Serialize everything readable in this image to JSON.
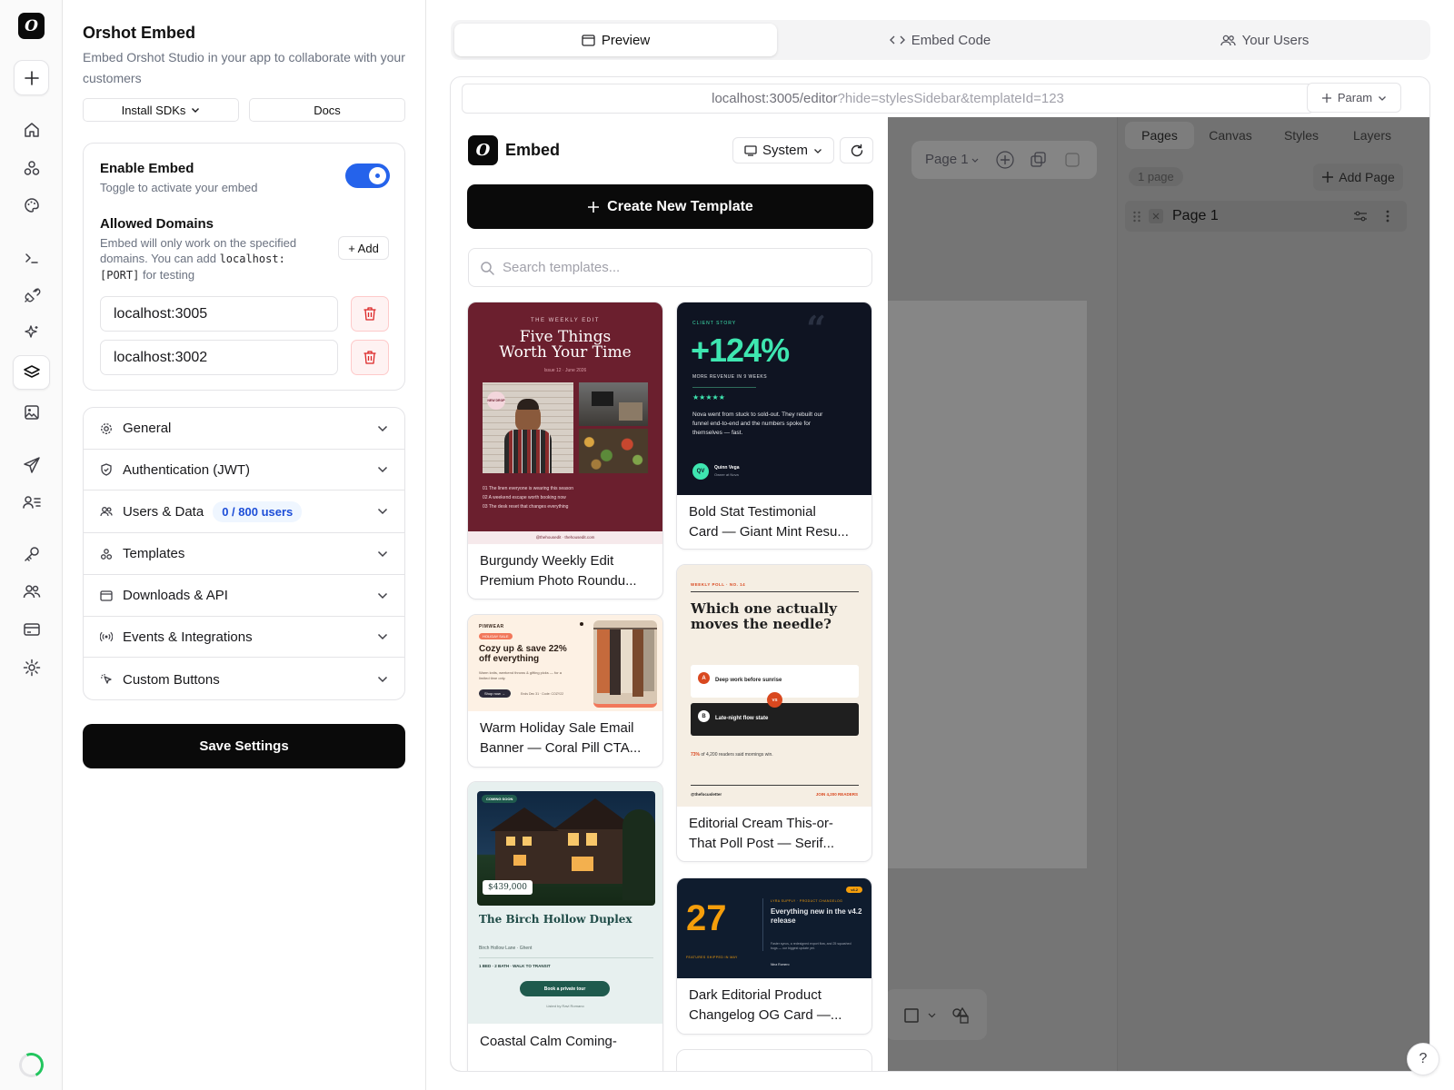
{
  "rail": {
    "logo_glyph": "O",
    "icons": [
      "plus-icon",
      "home-icon",
      "shapes-icon",
      "palette-icon",
      "terminal-icon",
      "plug-icon",
      "sparkles-icon",
      "layers-icon",
      "image-icon",
      "send-icon",
      "user-list-icon",
      "key-icon",
      "users-icon",
      "credit-card-icon",
      "settings-icon"
    ],
    "active": "layers-icon"
  },
  "panel": {
    "title": "Orshot Embed",
    "description": "Embed Orshot Studio in your app to collaborate with your customers",
    "install_sdks_label": "Install SDKs",
    "docs_label": "Docs",
    "enable": {
      "title": "Enable Embed",
      "subtitle": "Toggle to activate your embed",
      "enabled": true
    },
    "domains": {
      "title": "Allowed Domains",
      "desc_pre": "Embed will only work on the specified domains. You can add ",
      "desc_code1": "localhost:",
      "desc_code2": "[PORT]",
      "desc_post": " for testing",
      "add_label": "+ Add",
      "items": [
        "localhost:3005",
        "localhost:3002"
      ]
    },
    "sections": [
      {
        "label": "General",
        "icon": "gear-icon"
      },
      {
        "label": "Authentication (JWT)",
        "icon": "shield-check-icon"
      },
      {
        "label": "Users & Data",
        "icon": "users-icon",
        "badge": "0 / 800 users"
      },
      {
        "label": "Templates",
        "icon": "shapes-icon"
      },
      {
        "label": "Downloads & API",
        "icon": "download-icon"
      },
      {
        "label": "Events & Integrations",
        "icon": "radio-icon"
      },
      {
        "label": "Custom Buttons",
        "icon": "pointer-icon"
      }
    ],
    "save_label": "Save Settings"
  },
  "main": {
    "tabs": [
      {
        "label": "Preview",
        "icon": "preview-icon",
        "active": true
      },
      {
        "label": "Embed Code",
        "icon": "code-icon",
        "active": false
      },
      {
        "label": "Your Users",
        "icon": "users-icon",
        "active": false
      }
    ],
    "url_base": "localhost:3005/editor",
    "url_query": "?hide=stylesSidebar&templateId=123",
    "param_label": "Param"
  },
  "editor": {
    "page_label": "Page 1",
    "right_tabs": [
      "Pages",
      "Canvas",
      "Styles",
      "Layers"
    ],
    "active_right_tab": "Pages",
    "page_count": "1 page",
    "add_page_label": "Add Page",
    "page_item": "Page 1"
  },
  "embed": {
    "title": "Embed",
    "theme_label": "System",
    "create_label": "Create New Template",
    "search_placeholder": "Search templates...",
    "templates": [
      {
        "title": "Burgundy Weekly Edit Premium Photo Roundu...",
        "line1": "Burgundy Weekly Edit",
        "line2": "Premium Photo Roundu...",
        "thumb": {
          "kicker": "THE WEEKLY EDIT",
          "headline1": "Five Things",
          "headline2": "Worth Your Time",
          "issue": "Issue 12 · June 2026",
          "sticker": "NEW DROP",
          "items": [
            "01 The linen everyone is wearing this season",
            "02 A weekend escape worth booking now",
            "03 The desk reset that changes everything"
          ],
          "footer": "@thehousedit · thehousedit.com"
        }
      },
      {
        "title": "Bold Stat Testimonial Card — Giant Mint Resu...",
        "line1": "Bold Stat Testimonial",
        "line2": "Card — Giant Mint Resu...",
        "thumb": {
          "kicker": "CLIENT STORY",
          "stat": "+124%",
          "sub": "MORE REVENUE IN 9 WEEKS",
          "stars": "★★★★★",
          "quote": "Nova went from stuck to sold-out. They rebuilt our funnel end-to-end and the numbers spoke for themselves — fast.",
          "initials": "QV",
          "name": "Quinn Vega",
          "role": "Owner at Nova"
        }
      },
      {
        "title": "Warm Holiday Sale Email Banner — Coral Pill CTA...",
        "line1": "Warm Holiday Sale Email",
        "line2": "Banner — Coral Pill CTA...",
        "thumb": {
          "brand": "PIMWEAR",
          "pill": "HOLIDAY SALE",
          "headline": "Cozy up & save 22% off everything",
          "body": "Warm knits, weekend throws & gifting picks — for a limited time only.",
          "cta": "Shop now →",
          "fine": "Ends Dec 31 · Code: COZY22"
        }
      },
      {
        "title": "Editorial Cream This-or-That Poll Post — Serif...",
        "line1": "Editorial Cream This-or-",
        "line2": "That Poll Post — Serif...",
        "thumb": {
          "kicker": "WEEKLY POLL · NO. 14",
          "headline": "Which one actually moves the needle?",
          "opt_a": "Deep work before sunrise",
          "opt_b": "Late-night flow state",
          "vs": "VS",
          "stat_strong": "73%",
          "stat_rest": " of 4,200 readers said mornings win.",
          "handle": "@thefocusletter",
          "join": "JOIN 4,200 READERS"
        }
      },
      {
        "title": "Coastal Calm Coming-Soon Listing",
        "line1": "Coastal Calm Coming-",
        "line2": "",
        "thumb": {
          "pill": "COMING SOON",
          "price": "$439,000",
          "headline": "The Birch Hollow Duplex",
          "address": "Birch Hollow Lane · Ghent",
          "features": "1 BED · 2 BATH · WALK TO TRANSIT",
          "cta": "Book a private tour",
          "listed": "Listed by Ravi Romano"
        }
      },
      {
        "title": "Dark Editorial Product Changelog OG Card —...",
        "line1": "Dark Editorial Product",
        "line2": "Changelog OG Card —...",
        "thumb": {
          "version": "v4.2",
          "number": "27",
          "kicker": "LYRA SUPPLY · PRODUCT CHANGELOG",
          "headline": "Everything new in the v4.2 release",
          "sub": "FEATURES SHIPPED IN MAY",
          "body": "Faster syncs, a redesigned export flow, and 25 squashed bugs — our biggest update yet.",
          "author": "Nina Romero"
        }
      }
    ]
  },
  "help_glyph": "?"
}
